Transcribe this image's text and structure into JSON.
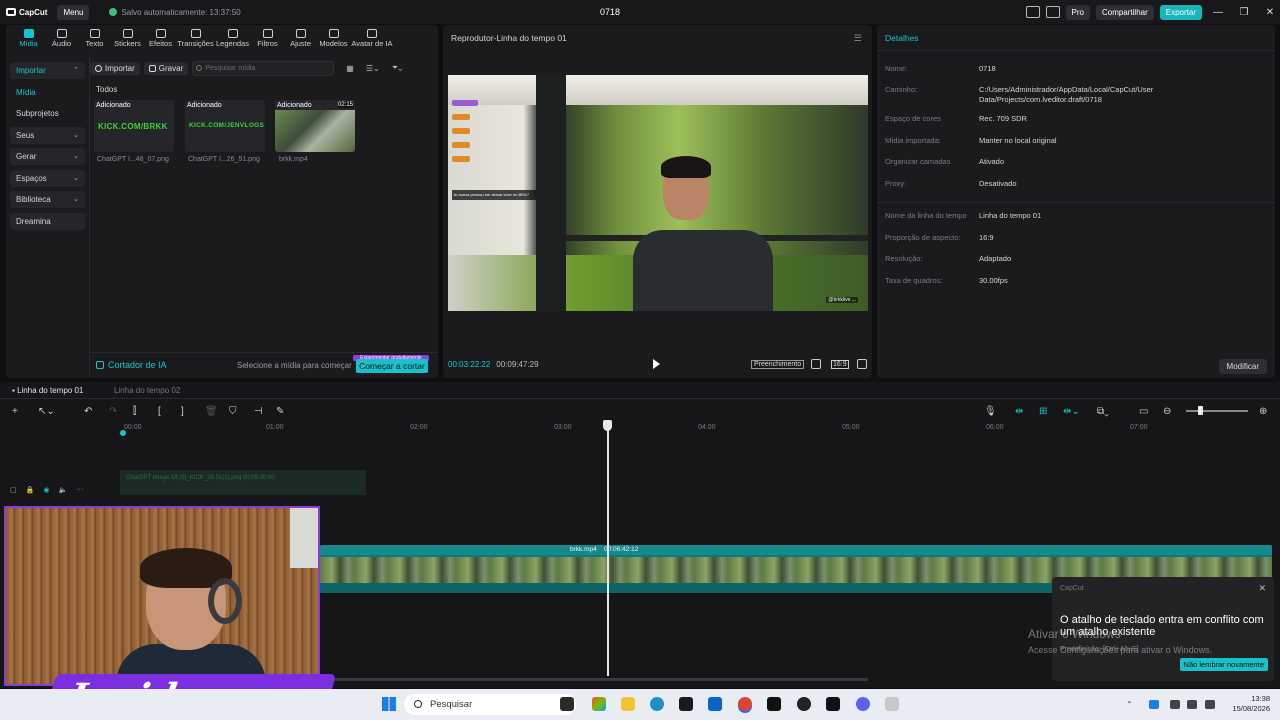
{
  "app": {
    "name": "CapCut",
    "menu_label": "Menu",
    "autosave": "Salvo automaticamente: 13:37:50",
    "project_title": "0718",
    "pro_label": "Pro",
    "share_label": "Compartilhar",
    "export_label": "Exportar"
  },
  "tools": [
    "Mídia",
    "Áudio",
    "Texto",
    "Stickers",
    "Efeitos",
    "Transições",
    "Legendas",
    "Filtros",
    "Ajuste",
    "Modelos",
    "Avatar de IA"
  ],
  "sidebar": {
    "items": [
      {
        "label": "Importar"
      },
      {
        "label": "Mídia"
      },
      {
        "label": "Subprojetos"
      },
      {
        "label": "Seus"
      },
      {
        "label": "Gerar"
      },
      {
        "label": "Espaços"
      },
      {
        "label": "Biblioteca"
      },
      {
        "label": "Dreamina"
      }
    ]
  },
  "media": {
    "import_label": "Importar",
    "record_label": "Gravar",
    "search_placeholder": "Pesquisar mídia",
    "section_label": "Todos",
    "items": [
      {
        "tag": "Adicionado",
        "name": "ChatGPT I...48_07.png",
        "thumb_text": "KICK.COM/BRKK"
      },
      {
        "tag": "Adicionado",
        "name": "ChatGPT I...26_51.png",
        "thumb_text": "KICK.COM/JENVLOGS"
      },
      {
        "tag": "Adicionado",
        "name": "brkk.mp4",
        "duration": "02:15"
      }
    ],
    "cutter_label": "Cortador de IA",
    "select_hint": "Selecione a mídia para começar",
    "start_label": "Começar a cortar",
    "ribbon": "Experimentar gratuitamente"
  },
  "player": {
    "title": "Reprodutor-Linha do tempo 01",
    "current_time": "00:03:22:22",
    "total_time": "00:09:47:29",
    "fill_label": "Preenchimento",
    "ratio_label": "16:9",
    "chat_text": "tu nunca pensou em deixar viver no BRA?",
    "watermark": "@brkklive ..."
  },
  "details": {
    "title": "Detalhes",
    "rows": [
      {
        "key": "Nome:",
        "value": "0718"
      },
      {
        "key": "Caminho:",
        "value": "C:/Users/Administrador/AppData/Local/CapCut/User Data/Projects/com.lveditor.draft/0718"
      },
      {
        "key": "Espaço de cores",
        "value": "Rec. 709 SDR"
      },
      {
        "key": "Mídia importada:",
        "value": "Manter no local original"
      },
      {
        "key": "Organizar camadas",
        "value": "Ativado"
      },
      {
        "key": "Proxy:",
        "value": "Desativado"
      },
      {
        "key": "Nome da linha do tempo",
        "value": "Linha do tempo 01"
      },
      {
        "key": "Proporção de aspecto:",
        "value": "16:9"
      },
      {
        "key": "Resolução:",
        "value": "Adaptado"
      },
      {
        "key": "Taxa de quadros:",
        "value": "30.00fps"
      }
    ],
    "modify_label": "Modificar"
  },
  "timeline": {
    "tabs": [
      "Linha do tempo 01",
      "Linha do tempo 02"
    ],
    "ruler": [
      "00:00",
      "01:00",
      "02:00",
      "03:00",
      "04:00",
      "05:00",
      "06:00",
      "07:00"
    ],
    "overlay_clip_label": "ChatGPT Image 18 (5)_KICK_26.51(1).png  00:05:00:00",
    "main_clip_label": "brkk.mp4",
    "main_clip_time": "00:06:42:12"
  },
  "toast": {
    "app": "CapCut",
    "message": "O atalho de teclado entra em conflito com um atalho existente",
    "hint": "Predefinição: [Ctrl+Alt+E]",
    "button": "Não lembrar novamente"
  },
  "watermark_windows": {
    "line1": "Ativar o Windows",
    "line2": "Acesse Configurações para ativar o Windows."
  },
  "webcam": {
    "brand": "Insider"
  },
  "taskbar": {
    "search_label": "Pesquisar",
    "time": "13:38",
    "date": "15/08/2026"
  },
  "colors": {
    "accent": "#19c5cc",
    "export": "#18b5bd",
    "brand_purple": "#7b2fe0"
  }
}
